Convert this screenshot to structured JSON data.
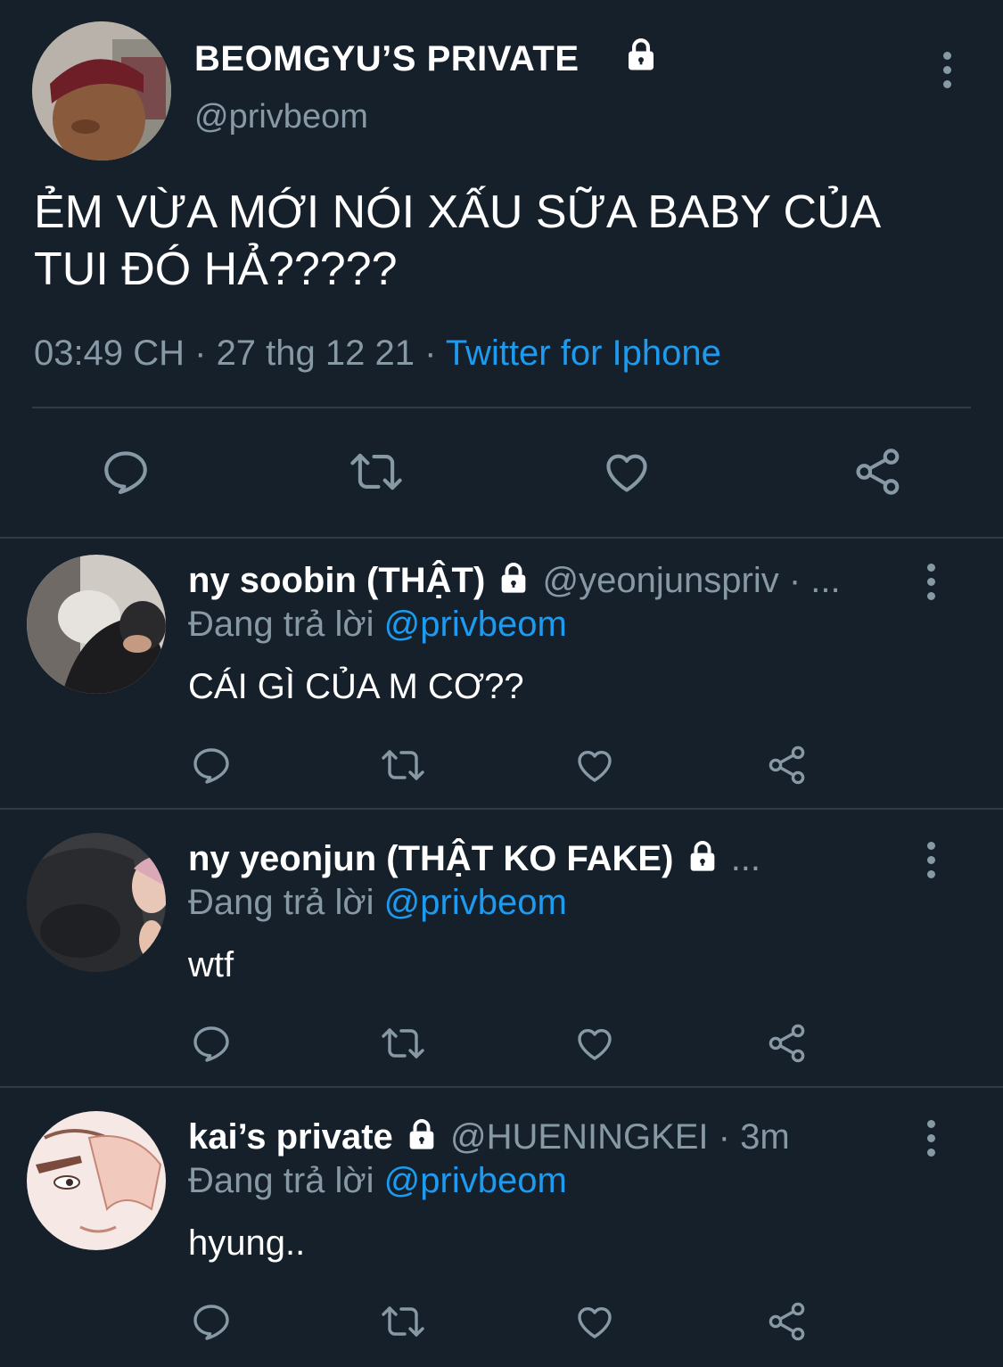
{
  "main_tweet": {
    "display_name": "BEOMGYU’S PRIVATE",
    "handle": "@privbeom",
    "text_line1": "ẺM VỪA MỚI NÓI XẤU SỮA BABY CỦA",
    "text_line2": "TUI ĐÓ HẢ?????",
    "time": "03:49 CH",
    "separator": "·",
    "date": "27 thg 12 21",
    "source": "Twitter for Iphone"
  },
  "replies": [
    {
      "display_name": "ny soobin (THẬT)",
      "handle": "@yeonjunspriv",
      "meta_suffix": "· ...",
      "replying_label": "Đang trả lời",
      "reply_to": "@privbeom",
      "text": "CÁI GÌ CỦA M CƠ??"
    },
    {
      "display_name": "ny yeonjun (THẬT KO FAKE)",
      "meta_suffix": "...",
      "replying_label": "Đang trả lời",
      "reply_to": "@privbeom",
      "text": "wtf"
    },
    {
      "display_name": "kai’s private",
      "handle": "@HUENINGKEI",
      "meta_suffix": "· 3m",
      "replying_label": "Đang trả lời",
      "reply_to": "@privbeom",
      "text": "hyung.."
    }
  ],
  "icons": {
    "reply": "reply-icon",
    "retweet": "retweet-icon",
    "like": "heart-icon",
    "share": "share-icon",
    "lock": "lock-icon",
    "more": "more-vertical-icon"
  },
  "colors": {
    "background": "#15202b",
    "text": "#ffffff",
    "muted": "#8899a6",
    "accent": "#1d9bf0",
    "divider": "#2f3b47"
  }
}
